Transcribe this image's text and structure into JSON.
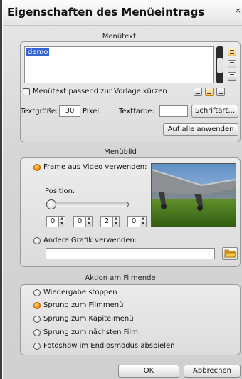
{
  "dialog": {
    "title": "Eigenschaften des Menüeintrags",
    "close_glyph": "×"
  },
  "menutext": {
    "section_title": "Menütext:",
    "text_value": "demo",
    "shorten_checkbox_label": "Menütext passend zur Vorlage kürzen",
    "shorten_checked": false,
    "textsize_label": "Textgröße:",
    "textsize_value": "30",
    "textsize_unit": "Pixel",
    "textcolor_label": "Textfarbe:",
    "textcolor_value": "#ffffff",
    "font_button": "Schriftart...",
    "apply_all_button": "Auf alle anwenden"
  },
  "menubild": {
    "section_title": "Menübild",
    "frame_radio_label": "Frame aus Video verwenden:",
    "frame_radio_selected": true,
    "position_label": "Position:",
    "position_fields": [
      "0",
      "0",
      "2",
      "0"
    ],
    "other_graphic_label": "Andere Grafik verwenden:",
    "other_graphic_selected": false,
    "other_graphic_path": "",
    "thumbnail_icon": "video-frame-thumbnail",
    "browse_icon": "folder-icon"
  },
  "aktion": {
    "section_title": "Aktion am Filmende",
    "options": [
      {
        "label": "Wiedergabe stoppen",
        "selected": false
      },
      {
        "label": "Sprung zum Filmmenü",
        "selected": true
      },
      {
        "label": "Sprung zum Kapitelmenü",
        "selected": false
      },
      {
        "label": "Sprung zum nächsten Film",
        "selected": false
      },
      {
        "label": "Fotoshow im Endlosmodus abspielen",
        "selected": false
      }
    ]
  },
  "footer": {
    "ok_button": "OK",
    "cancel_button": "Abbrechen"
  },
  "colors": {
    "accent": "#f39200",
    "selection": "#3565d3"
  }
}
